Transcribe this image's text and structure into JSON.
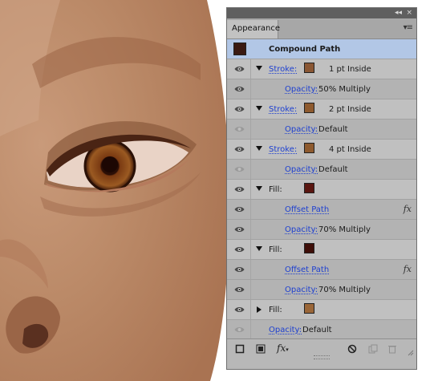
{
  "panel": {
    "title": "Appearance",
    "collapse_glyph": "◂◂",
    "close_glyph": "×",
    "menu_glyph": "▾≡"
  },
  "header": {
    "label": "Compound Path",
    "swatch_color": "#3a1a12"
  },
  "rows": [
    {
      "kind": "stroke",
      "prefix": "Stroke:",
      "value": "1 pt  Inside",
      "color": "#8a5734",
      "eye": "on",
      "tri": "down"
    },
    {
      "kind": "opacity",
      "prefix": "Opacity:",
      "value": "50% Multiply",
      "eye": "on"
    },
    {
      "kind": "stroke",
      "prefix": "Stroke:",
      "value": "2 pt  Inside",
      "color": "#8e5a2e",
      "eye": "on",
      "tri": "down"
    },
    {
      "kind": "opacity",
      "prefix": "Opacity:",
      "value": "Default",
      "eye": "off"
    },
    {
      "kind": "stroke",
      "prefix": "Stroke:",
      "value": "4 pt  Inside",
      "color": "#8e5a2e",
      "eye": "on",
      "tri": "down"
    },
    {
      "kind": "opacity",
      "prefix": "Opacity:",
      "value": "Default",
      "eye": "off"
    },
    {
      "kind": "fill",
      "prefix": "Fill:",
      "color": "#5a1610",
      "eye": "on",
      "tri": "down"
    },
    {
      "kind": "effect",
      "prefix": "Offset Path",
      "fx": "fx",
      "eye": "on"
    },
    {
      "kind": "opacity",
      "prefix": "Opacity:",
      "value": "70% Multiply",
      "eye": "on"
    },
    {
      "kind": "fill",
      "prefix": "Fill:",
      "color": "#3e0e08",
      "eye": "on",
      "tri": "down"
    },
    {
      "kind": "effect",
      "prefix": "Offset Path",
      "fx": "fx",
      "eye": "on"
    },
    {
      "kind": "opacity",
      "prefix": "Opacity:",
      "value": "70% Multiply",
      "eye": "on"
    },
    {
      "kind": "fill",
      "prefix": "Fill:",
      "color": "#9a6638",
      "eye": "on",
      "tri": "right"
    },
    {
      "kind": "opacity_top",
      "prefix": "Opacity:",
      "value": "Default",
      "eye": "off"
    }
  ],
  "bottom": {
    "fx_label": "fx"
  }
}
